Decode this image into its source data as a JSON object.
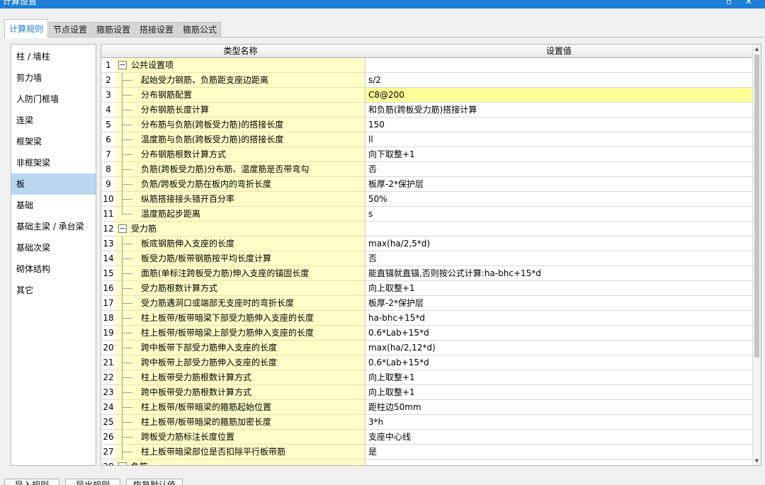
{
  "window": {
    "title": "计算设置"
  },
  "tabs": [
    {
      "label": "计算规则"
    },
    {
      "label": "节点设置"
    },
    {
      "label": "箍筋设置"
    },
    {
      "label": "搭接设置"
    },
    {
      "label": "箍筋公式"
    }
  ],
  "sidebar": {
    "selected": "板",
    "items": [
      {
        "label": "柱 / 墙柱"
      },
      {
        "label": "剪力墙"
      },
      {
        "label": "人防门框墙"
      },
      {
        "label": "连梁"
      },
      {
        "label": "框架梁"
      },
      {
        "label": "非框架梁"
      },
      {
        "label": "板"
      },
      {
        "label": "基础"
      },
      {
        "label": "基础主梁 / 承台梁"
      },
      {
        "label": "基础次梁"
      },
      {
        "label": "砌体结构"
      },
      {
        "label": "其它"
      }
    ]
  },
  "grid": {
    "columns": {
      "name": "类型名称",
      "value": "设置值"
    },
    "highlight_color": "#ffff99",
    "name_cell_color": "#ffffc7",
    "rows": [
      {
        "num": "1",
        "name": "公共设置项",
        "value": "",
        "group": true,
        "toggle": "−"
      },
      {
        "num": "2",
        "name": "起始受力钢筋、负筋距支座边距离",
        "value": "s/2"
      },
      {
        "num": "3",
        "name": "分布钢筋配置",
        "value": "C8@200",
        "highlight": true
      },
      {
        "num": "4",
        "name": "分布钢筋长度计算",
        "value": "和负筋(跨板受力筋)搭接计算"
      },
      {
        "num": "5",
        "name": "分布筋与负筋(跨板受力筋)的搭接长度",
        "value": "150"
      },
      {
        "num": "6",
        "name": "温度筋与负筋(跨板受力筋)的搭接长度",
        "value": "ll"
      },
      {
        "num": "7",
        "name": "分布钢筋根数计算方式",
        "value": "向下取整+1"
      },
      {
        "num": "8",
        "name": "负筋(跨板受力筋)分布筋、温度筋是否带弯勾",
        "value": "否"
      },
      {
        "num": "9",
        "name": "负筋/跨板受力筋在板内的弯折长度",
        "value": "板厚-2*保护层"
      },
      {
        "num": "10",
        "name": "纵筋搭接接头错开百分率",
        "value": "50%"
      },
      {
        "num": "11",
        "name": "温度筋起步距离",
        "value": "s",
        "last": true
      },
      {
        "num": "12",
        "name": "受力筋",
        "value": "",
        "group": true,
        "toggle": "−"
      },
      {
        "num": "13",
        "name": "板底钢筋伸入支座的长度",
        "value": "max(ha/2,5*d)"
      },
      {
        "num": "14",
        "name": "板受力筋/板带钢筋按平均长度计算",
        "value": "否"
      },
      {
        "num": "15",
        "name": "面筋(单标注跨板受力筋)伸入支座的锚固长度",
        "value": "能直锚就直锚,否则按公式计算:ha-bhc+15*d"
      },
      {
        "num": "16",
        "name": "受力筋根数计算方式",
        "value": "向上取整+1"
      },
      {
        "num": "17",
        "name": "受力筋遇洞口或端部无支座时的弯折长度",
        "value": "板厚-2*保护层"
      },
      {
        "num": "18",
        "name": "柱上板带/板带暗梁下部受力筋伸入支座的长度",
        "value": "ha-bhc+15*d"
      },
      {
        "num": "19",
        "name": "柱上板带/板带暗梁上部受力筋伸入支座的长度",
        "value": "0.6*Lab+15*d"
      },
      {
        "num": "20",
        "name": "跨中板带下部受力筋伸入支座的长度",
        "value": "max(ha/2,12*d)"
      },
      {
        "num": "21",
        "name": "跨中板带上部受力筋伸入支座的长度",
        "value": "0.6*Lab+15*d"
      },
      {
        "num": "22",
        "name": "柱上板带受力筋根数计算方式",
        "value": "向上取整+1"
      },
      {
        "num": "23",
        "name": "跨中板带受力筋根数计算方式",
        "value": "向上取整+1"
      },
      {
        "num": "24",
        "name": "柱上板带/板带暗梁的箍筋起始位置",
        "value": "距柱边50mm"
      },
      {
        "num": "25",
        "name": "柱上板带/板带暗梁的箍筋加密长度",
        "value": "3*h"
      },
      {
        "num": "26",
        "name": "跨板受力筋标注长度位置",
        "value": "支座中心线"
      },
      {
        "num": "27",
        "name": "柱上板带暗梁部位是否扣除平行板带筋",
        "value": "是"
      },
      {
        "num": "28",
        "name": "负筋",
        "value": "",
        "group": true,
        "toggle": "−"
      }
    ]
  },
  "footer": {
    "buttons": [
      {
        "label": "导入规则"
      },
      {
        "label": "导出规则"
      },
      {
        "label": "恢复默认值"
      }
    ]
  }
}
